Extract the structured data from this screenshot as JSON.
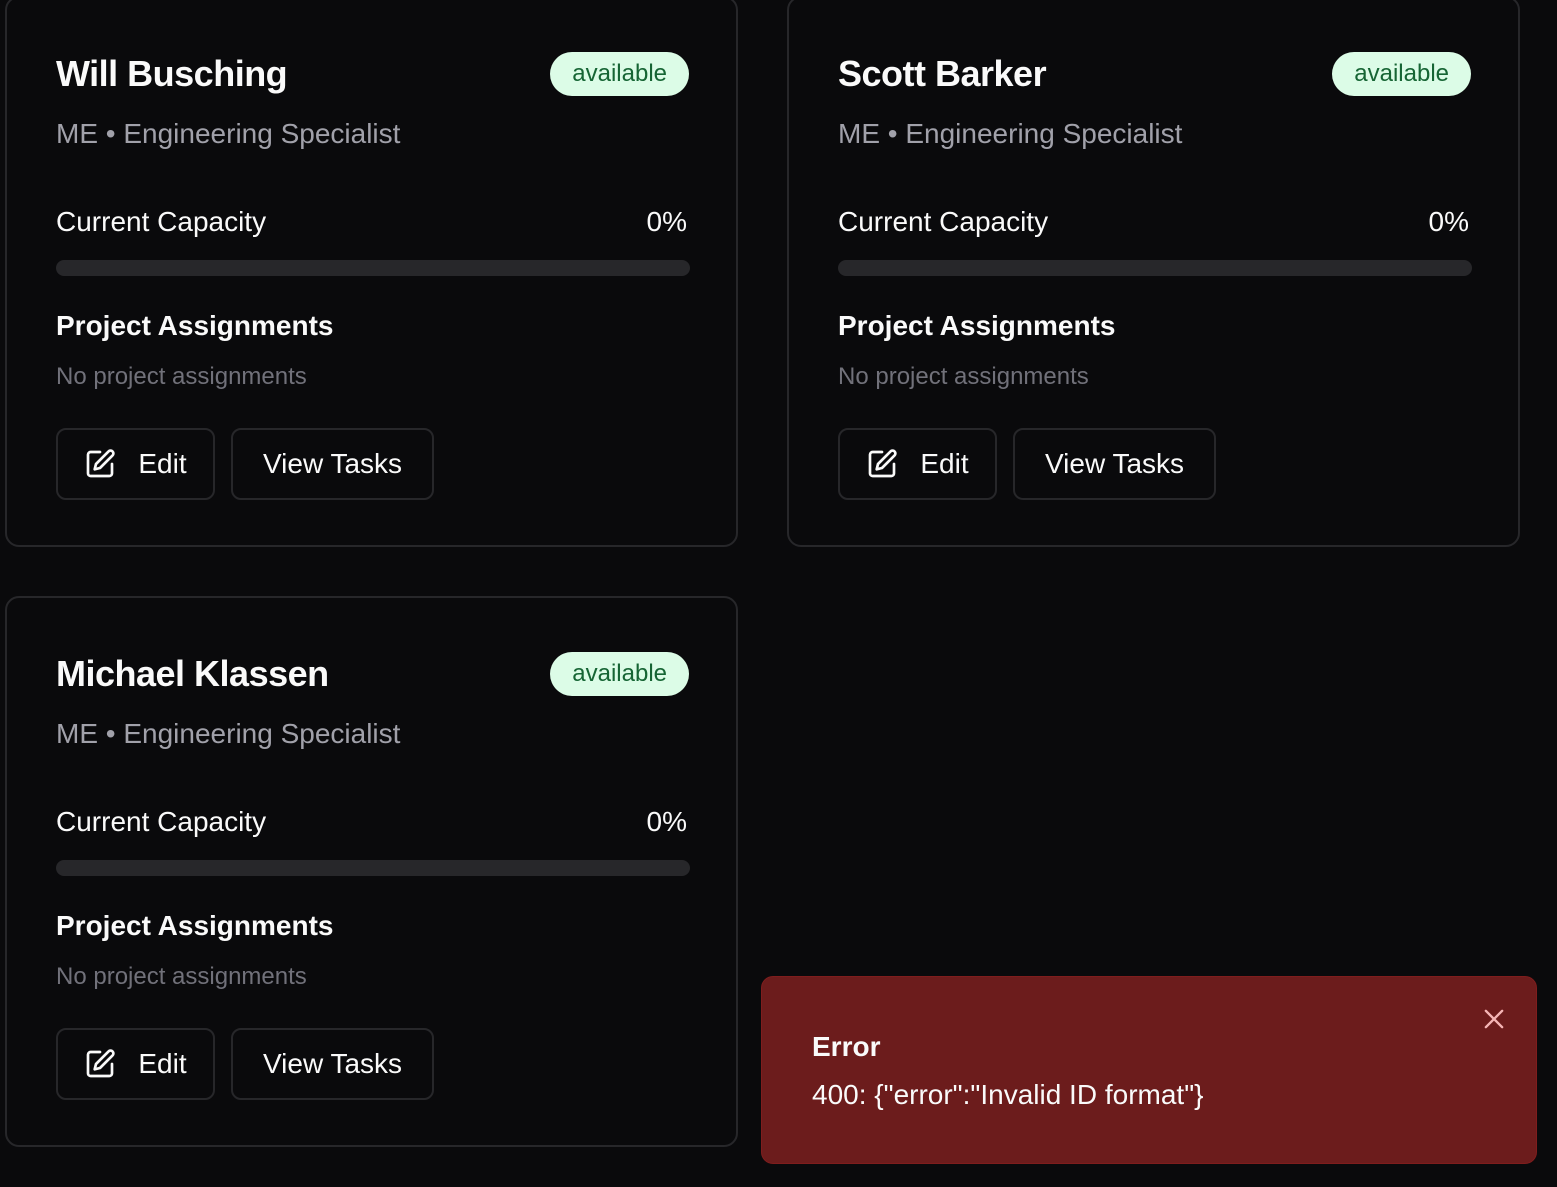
{
  "members": [
    {
      "name": "Will Busching",
      "status": "available",
      "role": "ME • Engineering Specialist",
      "capacity_label": "Current Capacity",
      "capacity_text": "0%",
      "capacity_fraction": 0,
      "assignments_heading": "Project Assignments",
      "assignments_empty": "No project assignments",
      "edit_label": "Edit",
      "view_tasks_label": "View Tasks"
    },
    {
      "name": "Scott Barker",
      "status": "available",
      "role": "ME • Engineering Specialist",
      "capacity_label": "Current Capacity",
      "capacity_text": "0%",
      "capacity_fraction": 0,
      "assignments_heading": "Project Assignments",
      "assignments_empty": "No project assignments",
      "edit_label": "Edit",
      "view_tasks_label": "View Tasks"
    },
    {
      "name": "Michael Klassen",
      "status": "available",
      "role": "ME • Engineering Specialist",
      "capacity_label": "Current Capacity",
      "capacity_text": "0%",
      "capacity_fraction": 0,
      "assignments_heading": "Project Assignments",
      "assignments_empty": "No project assignments",
      "edit_label": "Edit",
      "view_tasks_label": "View Tasks"
    }
  ],
  "toast": {
    "title": "Error",
    "message": "400: {\"error\":\"Invalid ID format\"}",
    "close_icon": "close-icon",
    "background": "#6c1c1c"
  },
  "colors": {
    "status_available_bg": "#dcfce7",
    "status_available_text": "#166534"
  },
  "icons": {
    "edit": "edit-icon"
  }
}
